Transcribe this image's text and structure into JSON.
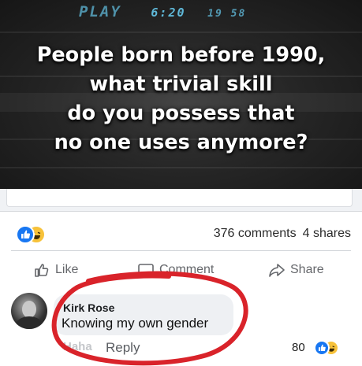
{
  "banner": {
    "vcr_mode": "PLAY",
    "vcr_time": "6:20",
    "vcr_counter": "19 58",
    "headline_lines": [
      "People born before 1990,",
      "what trivial skill",
      "do you possess that",
      "no one uses anymore?"
    ]
  },
  "stats": {
    "comments": "376 comments",
    "shares": "4 shares"
  },
  "actions": {
    "like": "Like",
    "comment": "Comment",
    "share": "Share"
  },
  "comment": {
    "author": "Kirk Rose",
    "text": "Knowing my own gender",
    "react_link": "Haha",
    "reply": "Reply",
    "reaction_count": "80"
  },
  "colors": {
    "accent_blue": "#1877f2",
    "haha_yellow": "#f7c23a",
    "highlight_red": "#d9232a"
  },
  "icons": [
    "like-reaction-icon",
    "haha-reaction-icon",
    "thumbs-up-icon",
    "comment-icon",
    "share-arrow-icon"
  ]
}
